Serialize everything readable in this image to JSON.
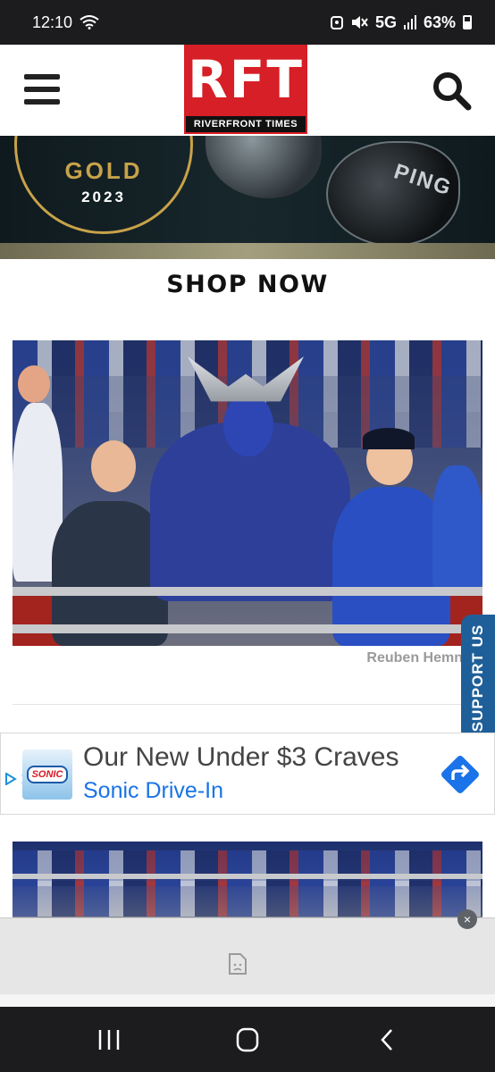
{
  "status_bar": {
    "time": "12:10",
    "network": "5G",
    "battery": "63%"
  },
  "header": {
    "logo_text": "RFT",
    "logo_subtitle": "RIVERFRONT TIMES"
  },
  "banner_ad": {
    "badge_title": "GOLD",
    "badge_year": "2023",
    "brand": "PING",
    "cta": "SHOP NOW"
  },
  "article": {
    "photo_credit": "Reuben Hemn"
  },
  "support_tab": {
    "label": "SUPPORT US"
  },
  "native_ad": {
    "headline": "Our New Under $3 Craves",
    "advertiser": "Sonic Drive-In",
    "logo_text": "SONIC",
    "adchoices_icon": "adchoices-icon",
    "close_icon": "close-icon"
  },
  "bottom_ad": {
    "close_label": "×"
  },
  "nav": {
    "icons": [
      "recents-icon",
      "home-icon",
      "back-icon"
    ]
  }
}
